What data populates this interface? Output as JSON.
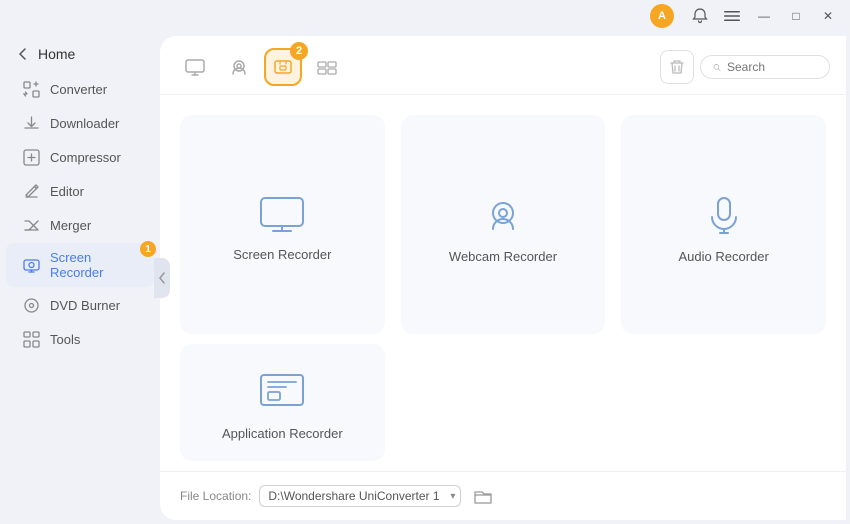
{
  "titlebar": {
    "avatar_initial": "A",
    "bell_label": "Notifications",
    "menu_label": "Menu",
    "minimize_label": "Minimize",
    "maximize_label": "Maximize",
    "close_label": "Close"
  },
  "sidebar": {
    "home_label": "Home",
    "items": [
      {
        "id": "converter",
        "label": "Converter",
        "badge": null
      },
      {
        "id": "downloader",
        "label": "Downloader",
        "badge": null
      },
      {
        "id": "compressor",
        "label": "Compressor",
        "badge": null
      },
      {
        "id": "editor",
        "label": "Editor",
        "badge": null
      },
      {
        "id": "merger",
        "label": "Merger",
        "badge": null
      },
      {
        "id": "screen-recorder",
        "label": "Screen Recorder",
        "badge": "1",
        "active": true
      },
      {
        "id": "dvd-burner",
        "label": "DVD Burner",
        "badge": null
      },
      {
        "id": "tools",
        "label": "Tools",
        "badge": null
      }
    ]
  },
  "toolbar": {
    "tabs": [
      {
        "id": "screen",
        "label": "Screen"
      },
      {
        "id": "webcam",
        "label": "Webcam"
      },
      {
        "id": "app-recorder",
        "label": "App Recorder",
        "active": true,
        "badge": "2"
      },
      {
        "id": "more",
        "label": "More"
      }
    ],
    "search_placeholder": "Search",
    "delete_label": "Delete"
  },
  "recorder_cards": {
    "top_row": [
      {
        "id": "screen-recorder",
        "label": "Screen Recorder",
        "icon": "screen"
      },
      {
        "id": "webcam-recorder",
        "label": "Webcam Recorder",
        "icon": "webcam"
      },
      {
        "id": "audio-recorder",
        "label": "Audio Recorder",
        "icon": "audio"
      }
    ],
    "bottom_row": [
      {
        "id": "application-recorder",
        "label": "Application Recorder",
        "icon": "application"
      }
    ]
  },
  "file_location": {
    "label": "File Location:",
    "path": "D:\\Wondershare UniConverter 1",
    "folder_icon": "folder"
  }
}
